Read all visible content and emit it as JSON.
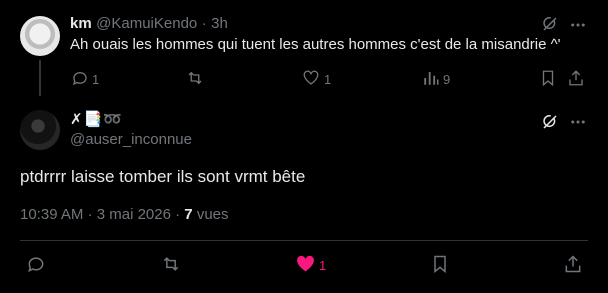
{
  "reply": {
    "name": "km",
    "handle": "@KamuiKendo",
    "separator": "·",
    "time": "3h",
    "text": "Ah ouais les hommes qui tuent les autres hommes c'est de la misandrie ^'",
    "reply_count": "1",
    "retweet_count": "",
    "like_count": "1",
    "views_count": "9"
  },
  "main": {
    "name_badges": "✗📑➿",
    "handle": "@auser_inconnue",
    "text": "ptdrrrr laisse tomber ils sont vrmt bête",
    "time": "10:39 AM",
    "sep": "·",
    "date": "3 mai 2026",
    "sep2": "·",
    "views": "7",
    "views_label": "vues",
    "like_count": "1"
  },
  "colors": {
    "background": "#000000",
    "text": "#e7e9ea",
    "muted": "#71767b",
    "like": "#f91880",
    "divider": "#2f3336"
  },
  "icons": [
    "grok-icon",
    "more-icon",
    "reply-icon",
    "retweet-icon",
    "like-icon",
    "views-icon",
    "bookmark-icon",
    "share-icon"
  ]
}
